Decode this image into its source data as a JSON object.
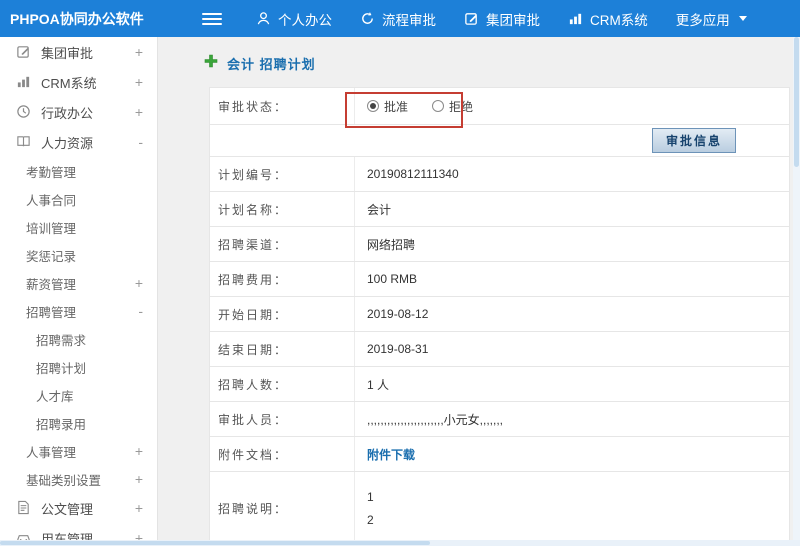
{
  "header": {
    "app_title": "PHPOA协同办公软件",
    "nav_items": [
      {
        "label": "个人办公",
        "icon": "person-icon"
      },
      {
        "label": "流程审批",
        "icon": "cycle-icon"
      },
      {
        "label": "集团审批",
        "icon": "edit-icon"
      },
      {
        "label": "CRM系统",
        "icon": "chart-icon"
      },
      {
        "label": "更多应用",
        "icon": "caret-down-icon"
      }
    ]
  },
  "sidebar": {
    "items": [
      {
        "label": "集团审批",
        "expander": "+"
      },
      {
        "label": "CRM系统",
        "expander": "+"
      },
      {
        "label": "行政办公",
        "expander": "+"
      },
      {
        "label": "人力资源",
        "expander": "-"
      },
      {
        "label": "考勤管理",
        "expander": ""
      },
      {
        "label": "人事合同",
        "expander": ""
      },
      {
        "label": "培训管理",
        "expander": ""
      },
      {
        "label": "奖惩记录",
        "expander": ""
      },
      {
        "label": "薪资管理",
        "expander": "+"
      },
      {
        "label": "招聘管理",
        "expander": "-"
      },
      {
        "label": "招聘需求",
        "expander": ""
      },
      {
        "label": "招聘计划",
        "expander": ""
      },
      {
        "label": "人才库",
        "expander": ""
      },
      {
        "label": "招聘录用",
        "expander": ""
      },
      {
        "label": "人事管理",
        "expander": "+"
      },
      {
        "label": "基础类别设置",
        "expander": "+"
      },
      {
        "label": "公文管理",
        "expander": "+"
      },
      {
        "label": "用车管理",
        "expander": "+"
      }
    ]
  },
  "main": {
    "title": "会计 招聘计划",
    "status_label": "审批状态：",
    "radio_approve": "批准",
    "radio_reject": "拒绝",
    "approval_status_selected": "批准",
    "approval_info_button": "审批信息",
    "fields": [
      {
        "label": "计划编号：",
        "value": "20190812111340"
      },
      {
        "label": "计划名称：",
        "value": "会计"
      },
      {
        "label": "招聘渠道：",
        "value": "网络招聘"
      },
      {
        "label": "招聘费用：",
        "value": "100 RMB"
      },
      {
        "label": "开始日期：",
        "value": "2019-08-12"
      },
      {
        "label": "结束日期：",
        "value": "2019-08-31"
      },
      {
        "label": "招聘人数：",
        "value": "1 人"
      },
      {
        "label": "审批人员：",
        "value": ",,,,,,,,,,,,,,,,,,,,,,,小元女,,,,,,,"
      },
      {
        "label": "附件文档：",
        "value": "附件下载"
      },
      {
        "label": "招聘说明：",
        "value": "1",
        "value2": "2"
      }
    ],
    "colors": {
      "header_blue": "#1d80d8",
      "accent_blue": "#1a6eae",
      "annotation_red": "#c53d32"
    }
  }
}
